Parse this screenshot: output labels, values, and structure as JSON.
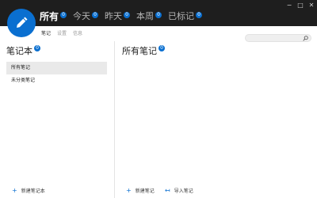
{
  "header": {
    "tabs": [
      {
        "label": "所有",
        "count": "0"
      },
      {
        "label": "今天",
        "count": "0"
      },
      {
        "label": "昨天",
        "count": "0"
      },
      {
        "label": "本周",
        "count": "0"
      },
      {
        "label": "已标记",
        "count": "0"
      }
    ]
  },
  "window_controls": {
    "minimize": "−",
    "maximize": "□",
    "close": "✕"
  },
  "subnav": {
    "notes": "笔记",
    "settings": "设置",
    "info": "信息"
  },
  "search": {
    "placeholder": ""
  },
  "sidebar": {
    "title": "笔记本",
    "count": "0",
    "items": [
      {
        "label": "所有笔记"
      },
      {
        "label": "未分类笔记"
      }
    ],
    "new_notebook": "新建笔记本"
  },
  "main": {
    "title": "所有笔记",
    "count": "0",
    "new_note": "新建笔记",
    "import_note": "导入笔记"
  },
  "colors": {
    "accent": "#0a6fd0",
    "header_bg": "#1e1e1e"
  },
  "icons": {
    "fab": "pencil-icon",
    "search": "search-icon",
    "add": "plus-icon",
    "import": "import-arrow-icon"
  }
}
